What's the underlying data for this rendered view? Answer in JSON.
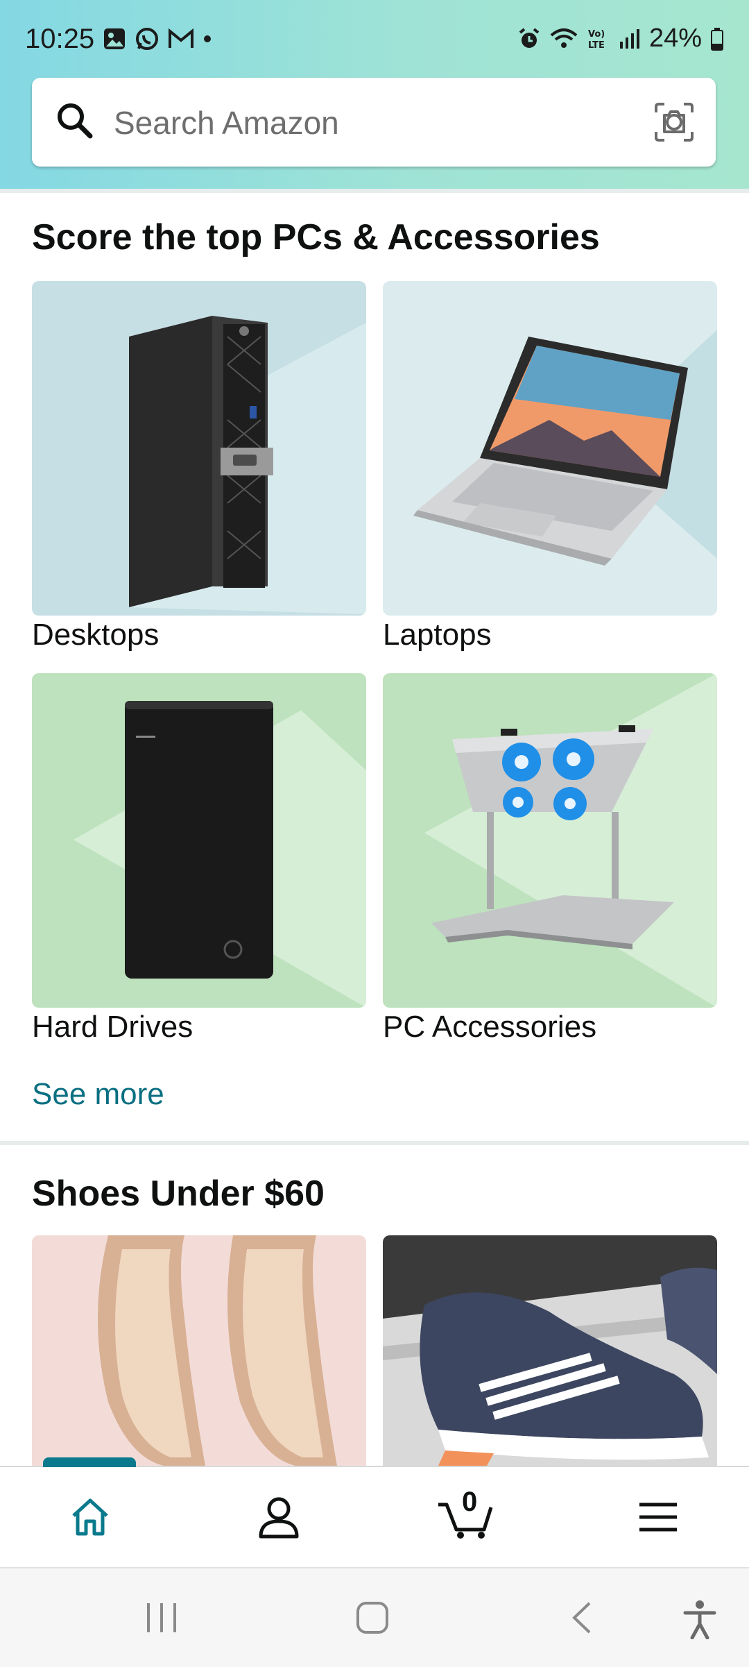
{
  "status_bar": {
    "time": "10:25",
    "battery": "24%"
  },
  "search": {
    "placeholder": "Search Amazon"
  },
  "section_pcs": {
    "title": "Score the top PCs & Accessories",
    "tiles": [
      {
        "label": "Desktops"
      },
      {
        "label": "Laptops"
      },
      {
        "label": "Hard Drives"
      },
      {
        "label": "PC Accessories"
      }
    ],
    "see_more": "See more"
  },
  "section_shoes": {
    "title": "Shoes Under $60"
  },
  "bottom_nav": {
    "cart_count": "0",
    "items": [
      "home-icon",
      "account-icon",
      "cart-icon",
      "menu-icon"
    ]
  },
  "colors": {
    "accent": "#0b7a8d",
    "link": "#0b6f82",
    "header_start": "#84d8e3",
    "header_end": "#a6e6cf"
  }
}
